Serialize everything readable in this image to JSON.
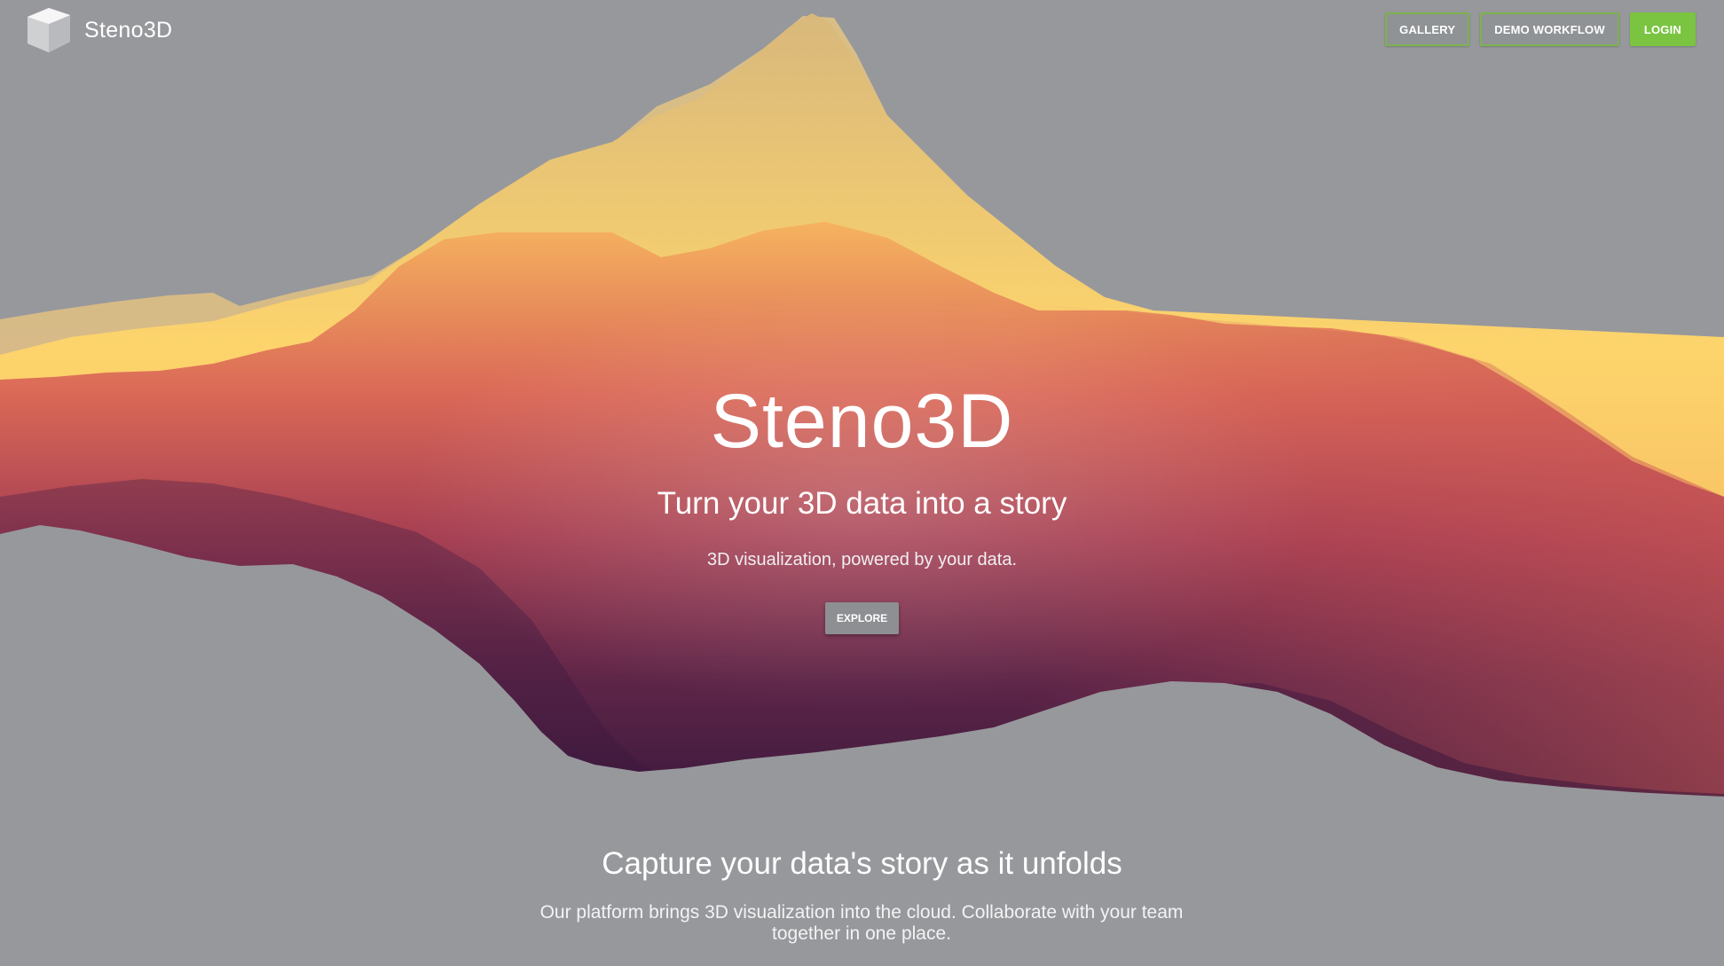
{
  "header": {
    "logo_text": "Steno3D",
    "nav": [
      {
        "label": "GALLERY"
      },
      {
        "label": "DEMO WORKFLOW"
      },
      {
        "label": "LOGIN"
      }
    ]
  },
  "hero": {
    "title": "Steno3D",
    "subtitle": "Turn your 3D data into a story",
    "description": "3D visualization, powered by your data.",
    "cta_label": "EXPLORE"
  },
  "section": {
    "title": "Capture your data's story as it unfolds",
    "text": "Our platform brings 3D visualization into the cloud. Collaborate with your team together in one place."
  },
  "icons": {
    "logo": "cube-icon"
  },
  "colors": {
    "background": "#97989c",
    "accent_green": "#7ac441",
    "terrain_yellow": "#fcd46a",
    "terrain_red": "#d45a55",
    "terrain_purple": "#3e1a3f"
  }
}
